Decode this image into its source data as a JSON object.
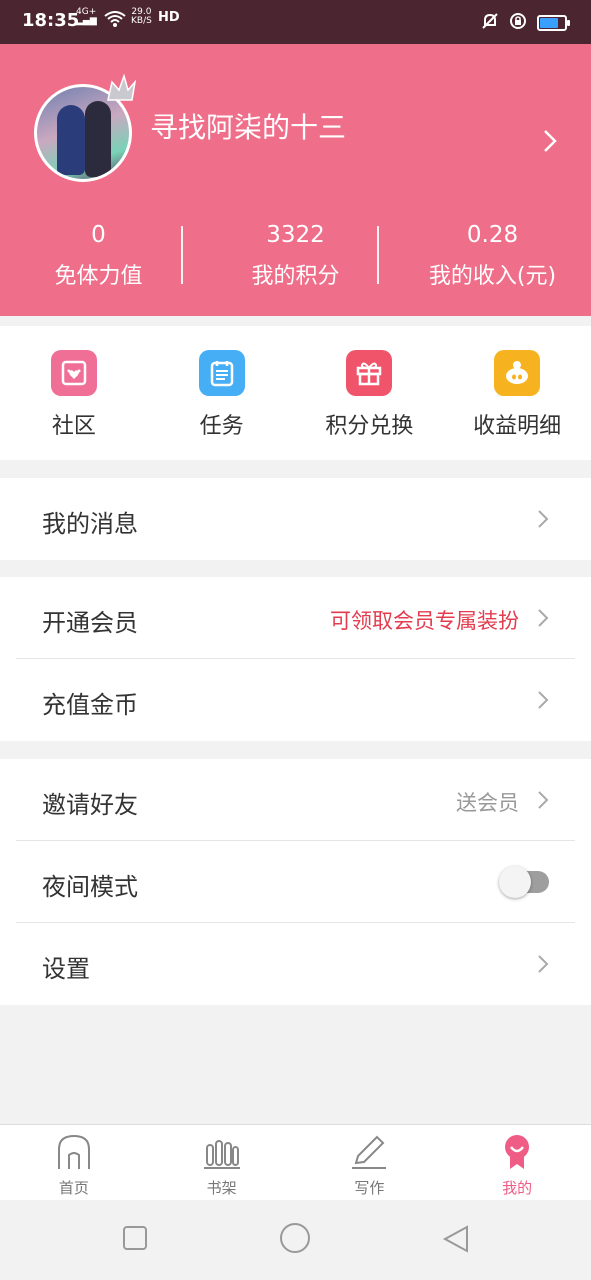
{
  "status_bar": {
    "time": "18:35",
    "network": "4G+",
    "speed_value": "29.0",
    "speed_unit": "KB/S",
    "hd": "HD",
    "battery_level": 0.75
  },
  "profile": {
    "username": "寻找阿柒的十三",
    "stats": [
      {
        "value": "0",
        "label": "免体力值"
      },
      {
        "value": "3322",
        "label": "我的积分"
      },
      {
        "value": "0.28",
        "label": "我的收入(元)"
      }
    ]
  },
  "quick_actions": [
    {
      "label": "社区",
      "icon": "community-icon",
      "color": "#f06f97"
    },
    {
      "label": "任务",
      "icon": "task-icon",
      "color": "#45aef5"
    },
    {
      "label": "积分兑换",
      "icon": "gift-icon",
      "color": "#f0546a"
    },
    {
      "label": "收益明细",
      "icon": "piggy-bank-icon",
      "color": "#f7b220"
    }
  ],
  "menu": {
    "messages": {
      "label": "我的消息"
    },
    "vip": {
      "label": "开通会员",
      "note": "可领取会员专属装扮"
    },
    "recharge": {
      "label": "充值金币"
    },
    "invite": {
      "label": "邀请好友",
      "note": "送会员"
    },
    "night_mode": {
      "label": "夜间模式",
      "enabled": false
    },
    "settings": {
      "label": "设置"
    }
  },
  "tabs": [
    {
      "label": "首页",
      "icon": "home-icon",
      "active": false
    },
    {
      "label": "书架",
      "icon": "bookshelf-icon",
      "active": false
    },
    {
      "label": "写作",
      "icon": "pen-icon",
      "active": false
    },
    {
      "label": "我的",
      "icon": "profile-icon",
      "active": true
    }
  ],
  "colors": {
    "header_bg": "#ef6e8a",
    "accent": "#ef5c86",
    "highlight_red": "#e33c4f"
  }
}
